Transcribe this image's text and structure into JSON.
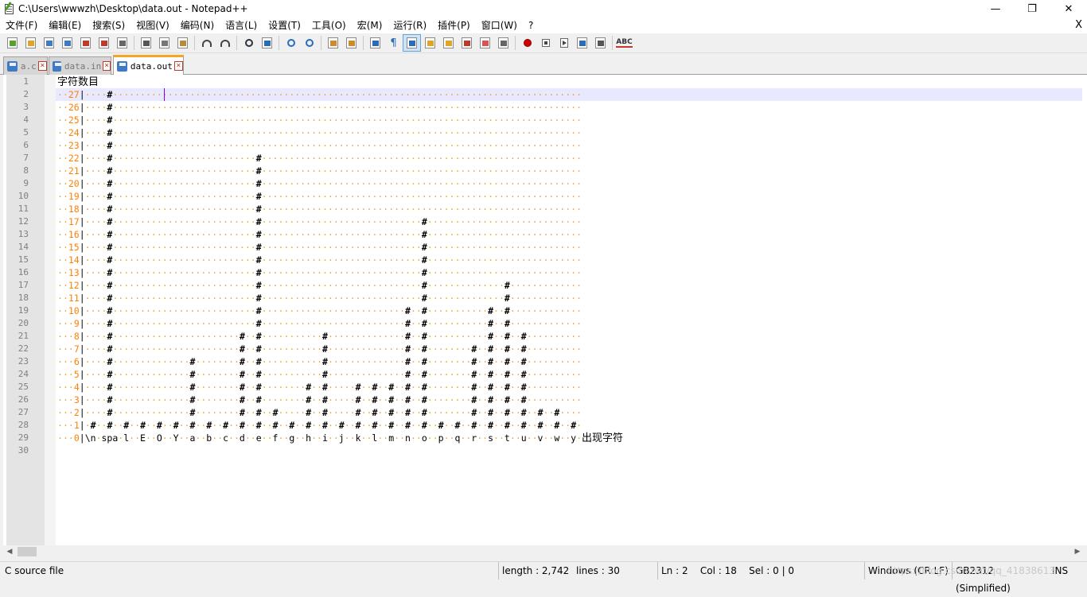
{
  "window": {
    "title": "C:\\Users\\wwwzh\\Desktop\\data.out - Notepad++",
    "minimize": "—",
    "maximize": "❐",
    "close": "✕"
  },
  "menu": {
    "items": [
      "文件(F)",
      "编辑(E)",
      "搜索(S)",
      "视图(V)",
      "编码(N)",
      "语言(L)",
      "设置(T)",
      "工具(O)",
      "宏(M)",
      "运行(R)",
      "插件(P)",
      "窗口(W)",
      "?"
    ],
    "close": "X"
  },
  "toolbar": {
    "icons": [
      "new-icon",
      "open-icon",
      "save-icon",
      "save-all-icon",
      "close-icon",
      "close-all-icon",
      "print-icon",
      "cut-icon",
      "copy-icon",
      "paste-icon",
      "undo-icon",
      "redo-icon",
      "find-icon",
      "replace-icon",
      "zoom-in-icon",
      "zoom-out-icon",
      "sync-v-icon",
      "sync-h-icon",
      "word-wrap-icon",
      "show-all-chars-icon",
      "indent-guide-icon",
      "udl-icon",
      "doc-map-icon",
      "function-list-icon",
      "folder-workspace-icon",
      "monitor-icon",
      "record-macro-icon",
      "stop-macro-icon",
      "play-macro-icon",
      "run-macro-multiple-icon",
      "save-macro-icon",
      "spell-check-icon"
    ]
  },
  "tabs": [
    {
      "label": "a.c",
      "active": false
    },
    {
      "label": "data.in",
      "active": false
    },
    {
      "label": "data.out",
      "active": true
    }
  ],
  "editor": {
    "current_line": 2,
    "header": "字符数目",
    "footer_label": "出现字符",
    "axis_labels": [
      "\\n",
      "spa",
      "l",
      "E",
      "O",
      "Y",
      "a",
      "b",
      "c",
      "d",
      "e",
      "f",
      "g",
      "h",
      "i",
      "j",
      "k",
      "l",
      "m",
      "n",
      "o",
      "p",
      "q",
      "r",
      "s",
      "t",
      "u",
      "v",
      "w",
      "y"
    ],
    "counts": [
      1,
      27,
      1,
      1,
      1,
      1,
      6,
      1,
      1,
      8,
      22,
      2,
      1,
      4,
      8,
      1,
      4,
      4,
      4,
      10,
      17,
      1,
      1,
      7,
      10,
      12,
      8,
      2,
      2,
      1
    ],
    "max_level": 27
  },
  "status": {
    "file_type": "C source file",
    "length": "length : 2,742",
    "lines": "lines : 30",
    "position": "Ln : 2    Col : 18    Sel : 0 | 0",
    "eol": "Windows (CR LF)",
    "encoding": "GB2312 (Simplified)",
    "mode": "INS",
    "watermark": "https://blog.csdn.net/qq_41838613"
  }
}
